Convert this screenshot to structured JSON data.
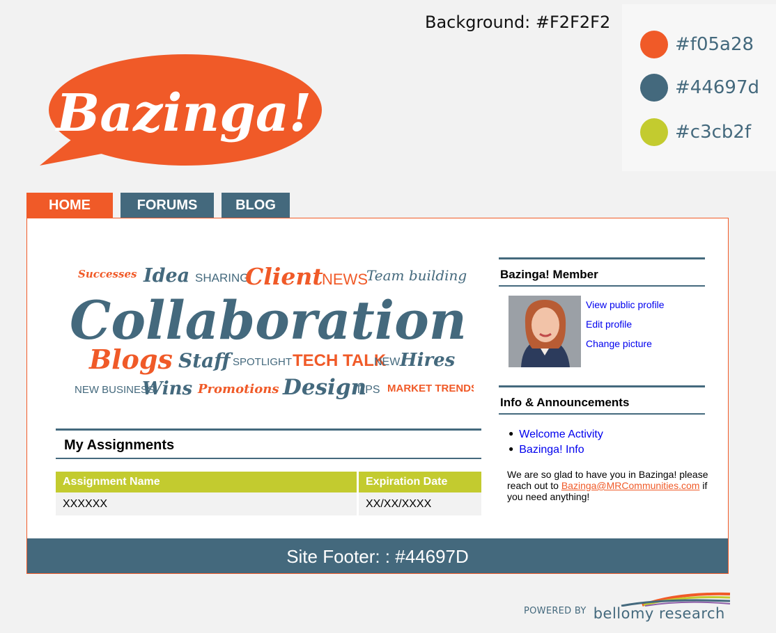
{
  "annotations": {
    "background_label": "Background: #F2F2F2",
    "palette": [
      {
        "color": "#f05a28",
        "label": "#f05a28"
      },
      {
        "color": "#44697d",
        "label": "#44697d"
      },
      {
        "color": "#c3cb2f",
        "label": "#c3cb2f"
      }
    ]
  },
  "logo": {
    "text": "Bazinga!",
    "color": "#f05a28"
  },
  "nav": {
    "tabs": [
      {
        "label": "HOME",
        "active": true
      },
      {
        "label": "FORUMS",
        "active": false
      },
      {
        "label": "BLOG",
        "active": false
      }
    ]
  },
  "wordcloud": {
    "words": {
      "successes": "Successes",
      "idea": "Idea",
      "sharing": "SHARING",
      "client": "Client",
      "news": "NEWS",
      "team_building": "Team building",
      "collaboration": "Collaboration",
      "blogs": "Blogs",
      "staff": "Staff",
      "spotlight": "SPOTLIGHT",
      "tech_talk": "TECH TALK",
      "new": "NEW",
      "hires": "Hires",
      "new_business": "NEW BUSINESS",
      "wins": "Wins",
      "promotions": "Promotions",
      "design": "Design",
      "tips": "TIPS",
      "market_trends": "MARKET TRENDS"
    }
  },
  "assignments": {
    "title": "My Assignments",
    "columns": [
      "Assignment Name",
      "Expiration Date"
    ],
    "rows": [
      [
        "XXXXXX",
        "XX/XX/XXXX"
      ]
    ]
  },
  "member": {
    "title": "Bazinga! Member",
    "links": {
      "view": "View public profile",
      "edit": "Edit profile",
      "change": "Change picture"
    }
  },
  "announcements": {
    "title": "Info & Announcements",
    "items": [
      "Welcome Activity",
      "Bazinga! Info"
    ],
    "message_before": "We are so glad to have you in Bazinga! please reach out to ",
    "email": "Bazinga@MRCommunities.com",
    "message_after": " if you need anything!"
  },
  "footer": {
    "text": "Site Footer: : #44697D"
  },
  "powered_by": {
    "label": "POWERED BY",
    "brand": "bellomy research"
  }
}
